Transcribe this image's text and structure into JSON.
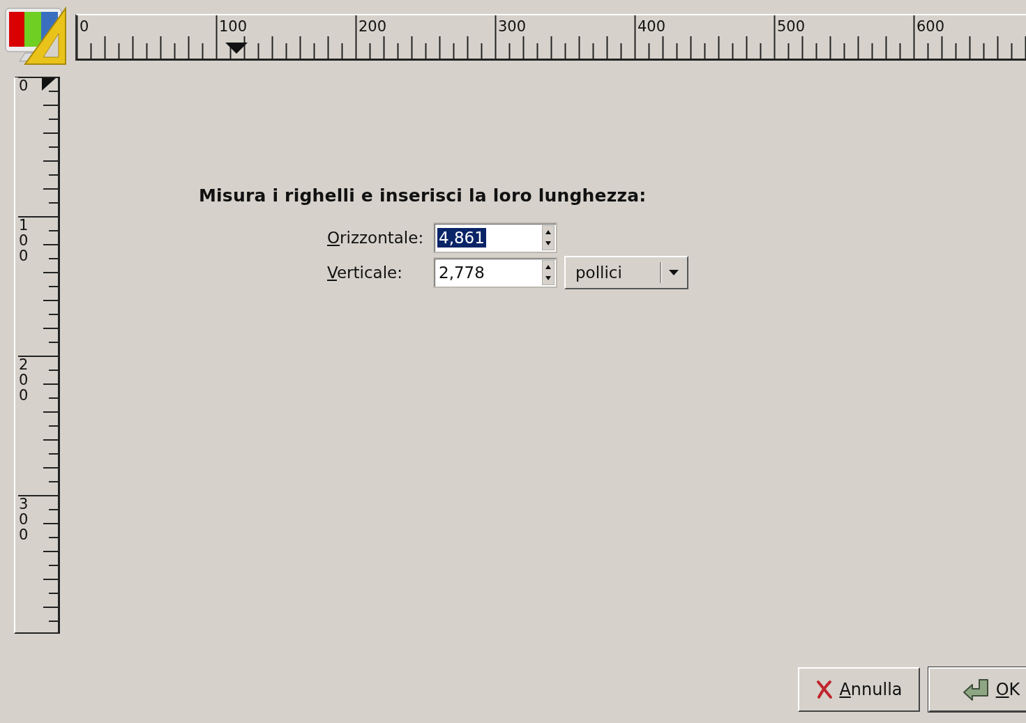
{
  "horizontal_ruler": {
    "labels": [
      "0",
      "100",
      "200",
      "300",
      "400",
      "500",
      "600"
    ]
  },
  "vertical_ruler": {
    "labels": [
      "0",
      "100",
      "200",
      "300"
    ]
  },
  "heading": "Misura i righelli e inserisci la loro lunghezza:",
  "fields": [
    {
      "label": "Orizzontale:",
      "value": "4,861",
      "selected": true
    },
    {
      "label": "Verticale:",
      "value": "2,778",
      "selected": false
    }
  ],
  "unit_dropdown": {
    "value": "pollici"
  },
  "buttons": [
    {
      "label": "Annulla",
      "kind": "cancel"
    },
    {
      "label": "OK",
      "kind": "ok"
    }
  ]
}
